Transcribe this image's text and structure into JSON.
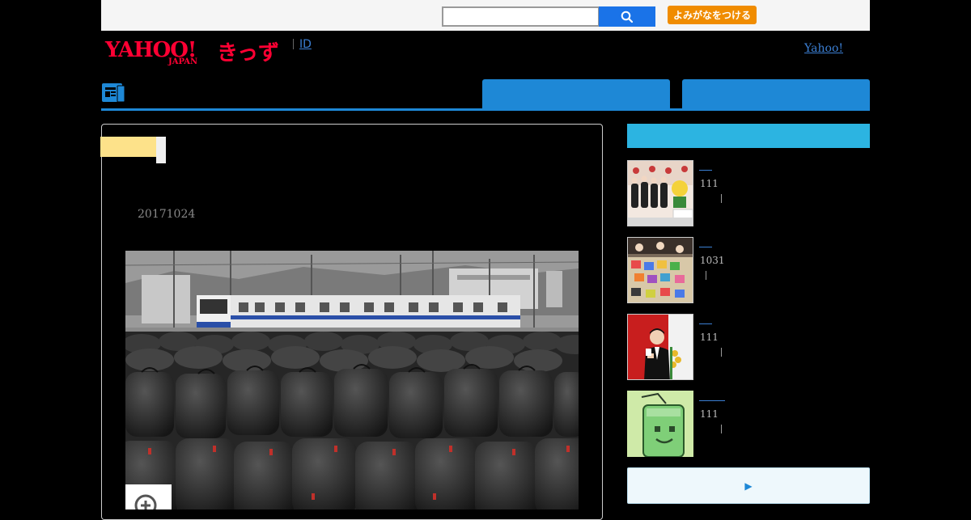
{
  "header": {
    "search": {
      "value": "",
      "placeholder": ""
    },
    "yomi_button_label": "よみがなをつける",
    "logo_text": "YAHOO!",
    "logo_kids": "きっず",
    "logo_sub": "JAPAN",
    "id_link": "ID",
    "yahoo_link": "Yahoo!"
  },
  "article": {
    "date": "20171024"
  },
  "sidebar": {
    "items": [
      {
        "count": "111"
      },
      {
        "count": "1031"
      },
      {
        "count": "111"
      },
      {
        "count": "111"
      }
    ],
    "more_icon": "▶"
  },
  "colors": {
    "accent_blue": "#1e88d6",
    "sidebar_header": "#2cb4e1",
    "logo_red": "#ff0033",
    "button_orange": "#f08c00",
    "tag_yellow": "#fde28a"
  },
  "icons": {
    "search": "search-icon",
    "nav": "news-icon",
    "zoom": "zoom-in-icon",
    "more": "play-triangle-icon"
  }
}
